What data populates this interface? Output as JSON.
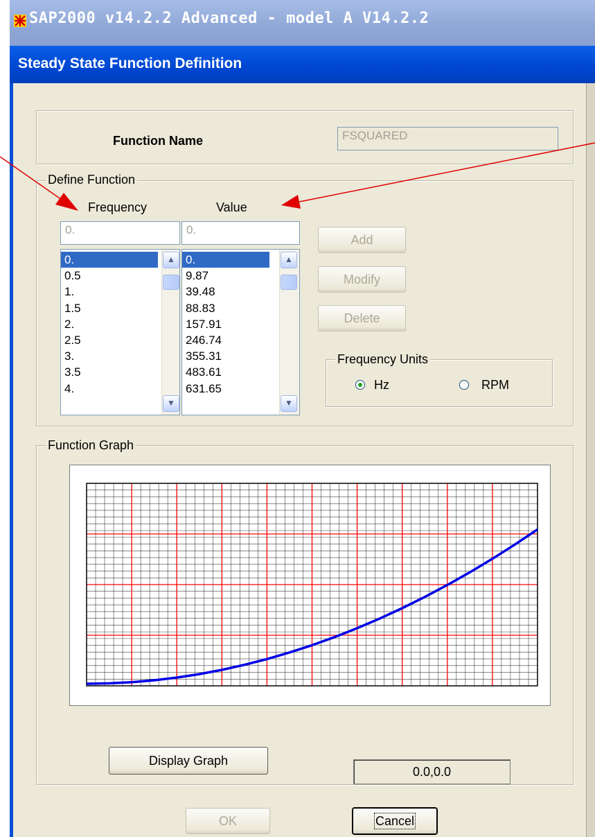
{
  "app": {
    "title": "SAP2000 v14.2.2 Advanced  - model A V14.2.2"
  },
  "dialog": {
    "title": "Steady State  Function Definition",
    "function_name_label": "Function Name",
    "function_name_value": "FSQUARED"
  },
  "define": {
    "legend": "Define Function",
    "frequency_header": "Frequency",
    "value_header": "Value",
    "frequency_input": "0.",
    "value_input": "0.",
    "frequencies": [
      "0.",
      "0.5",
      "1.",
      "1.5",
      "2.",
      "2.5",
      "3.",
      "3.5",
      "4."
    ],
    "values": [
      "0.",
      "9.87",
      "39.48",
      "88.83",
      "157.91",
      "246.74",
      "355.31",
      "483.61",
      "631.65"
    ],
    "selected_index": 0,
    "add_label": "Add",
    "modify_label": "Modify",
    "delete_label": "Delete"
  },
  "units": {
    "legend": "Frequency Units",
    "hz_label": "Hz",
    "rpm_label": "RPM",
    "selected": "Hz"
  },
  "graph": {
    "legend": "Function Graph",
    "display_button": "Display Graph",
    "readout": "0.0,0.0"
  },
  "chart_data": {
    "type": "line",
    "x": [
      0,
      0.5,
      1,
      1.5,
      2,
      2.5,
      3,
      3.5,
      4,
      4.5,
      5,
      5.5,
      6,
      6.5,
      7,
      7.5,
      8,
      8.5,
      9,
      9.5,
      10
    ],
    "values": [
      0,
      9.87,
      39.48,
      88.83,
      157.91,
      246.74,
      355.31,
      483.61,
      631.65,
      799.44,
      986.96,
      1194.22,
      1421.22,
      1667.96,
      1934.44,
      2220.66,
      2526.62,
      2852.32,
      3197.76,
      3562.94,
      3947.84
    ],
    "series_color": "#0000e6",
    "grid": true,
    "major_grid_color": "#ff0000",
    "minor_grid_color": "#000000"
  },
  "footer": {
    "ok_label": "OK",
    "cancel_label": "Cancel"
  }
}
